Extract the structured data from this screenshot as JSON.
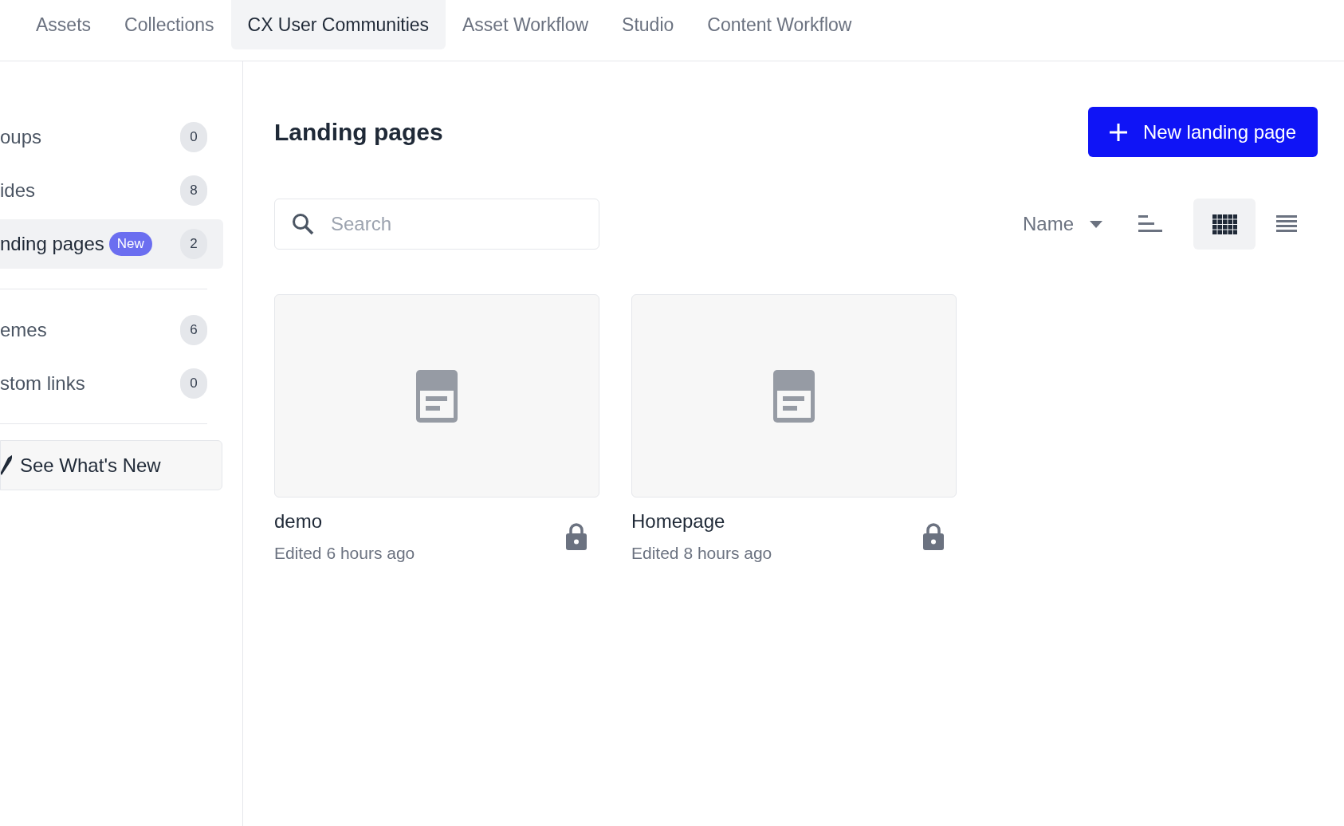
{
  "tabs": [
    {
      "label": "Assets",
      "selected": false
    },
    {
      "label": "Collections",
      "selected": false
    },
    {
      "label": "CX User Communities",
      "selected": true
    },
    {
      "label": "Asset Workflow",
      "selected": false
    },
    {
      "label": "Studio",
      "selected": false
    },
    {
      "label": "Content Workflow",
      "selected": false
    }
  ],
  "sidebar": {
    "sections": [
      {
        "items": [
          {
            "label": "oups",
            "count": "0",
            "selected": false
          },
          {
            "label": "ides",
            "count": "8",
            "selected": false
          },
          {
            "label": "nding pages",
            "tag": "New",
            "count": "2",
            "selected": true
          }
        ]
      },
      {
        "items": [
          {
            "label": "emes",
            "count": "6",
            "selected": false
          },
          {
            "label": "stom links",
            "count": "0",
            "selected": false
          }
        ]
      }
    ],
    "whats_new_button": "See What's New"
  },
  "main": {
    "title": "Landing pages",
    "new_button": "New landing page",
    "search": {
      "placeholder": "Search"
    },
    "sort": {
      "label": "Name"
    },
    "views": [
      {
        "kind": "grid",
        "selected": true
      },
      {
        "kind": "list",
        "selected": false
      }
    ],
    "cards": [
      {
        "name": "demo",
        "edited": "Edited 6 hours ago",
        "locked": true
      },
      {
        "name": "Homepage",
        "edited": "Edited 8 hours ago",
        "locked": true
      }
    ]
  }
}
